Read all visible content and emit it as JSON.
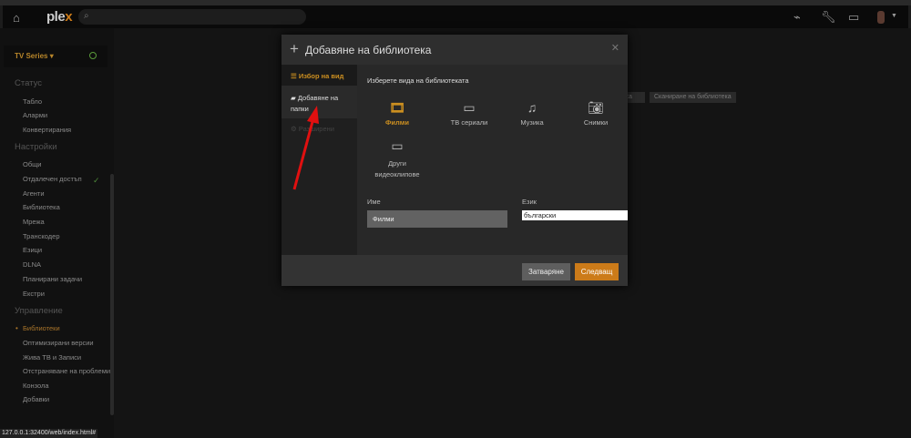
{
  "topbar": {
    "logo_main": "ple",
    "logo_accent": "x",
    "search_placeholder": ""
  },
  "sidebar": {
    "library_selector": "TV Series ▾",
    "sections": [
      {
        "title": "Статус",
        "items": [
          "Табло",
          "Аларми",
          "Конвертирания"
        ]
      },
      {
        "title": "Настройки",
        "items": [
          "Общи",
          "Отдалечен достъп",
          "Агенти",
          "Библиотека",
          "Мрежа",
          "Транскодер",
          "Езици",
          "DLNA",
          "Планирани задачи",
          "Екстри"
        ]
      },
      {
        "title": "Управление",
        "items": [
          "Библиотеки",
          "Оптимизирани версии",
          "Жива ТВ и Записи",
          "Отстраняване на проблеми",
          "Конзола",
          "Добавки"
        ]
      }
    ],
    "active_item": "Библиотеки"
  },
  "background": {
    "buttons": [
      "...ека",
      "Сканиране на библиотека"
    ]
  },
  "modal": {
    "title": "Добавяне на библиотека",
    "nav": [
      "Избор на вид",
      "Добавяне на папки",
      "Разширени"
    ],
    "prompt": "Изберете вида на библиотеката",
    "types": [
      {
        "label": "Филми",
        "icon": "film-icon",
        "selected": true
      },
      {
        "label": "ТВ сериали",
        "icon": "tv-icon",
        "selected": false
      },
      {
        "label": "Музика",
        "icon": "music-icon",
        "selected": false
      },
      {
        "label": "Снимки",
        "icon": "camera-icon",
        "selected": false
      },
      {
        "label": "Други видеоклипове",
        "icon": "video-camera-icon",
        "selected": false
      }
    ],
    "name_label": "Име",
    "name_value": "Филми",
    "language_label": "Език",
    "language_value": "български",
    "close_button": "Затваряне",
    "next_button": "Следващ"
  },
  "status_url": "127.0.0.1:32400/web/index.html#",
  "colors": {
    "accent": "#cc7b19",
    "annotation_arrow": "#e01010"
  }
}
